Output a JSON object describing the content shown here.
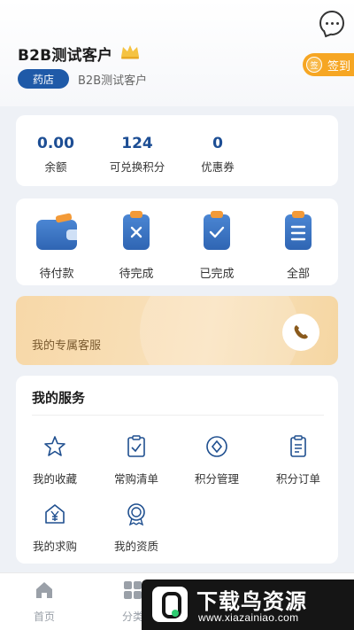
{
  "header": {
    "user_name": "B2B测试客户",
    "tag": "药店",
    "shop_name": "B2B测试客户",
    "signin": {
      "coin": "签",
      "label": "签到"
    }
  },
  "stats": [
    {
      "value": "0.00",
      "label": "余额"
    },
    {
      "value": "124",
      "label": "可兑换积分"
    },
    {
      "value": "0",
      "label": "优惠券"
    }
  ],
  "orders": [
    {
      "label": "待付款",
      "icon": "wallet-icon"
    },
    {
      "label": "待完成",
      "icon": "clipboard-x-icon"
    },
    {
      "label": "已完成",
      "icon": "clipboard-check-icon"
    },
    {
      "label": "全部",
      "icon": "clipboard-list-icon"
    }
  ],
  "service_banner": {
    "label": "我的专属客服",
    "icon": "phone-icon"
  },
  "services": {
    "title": "我的服务",
    "items": [
      {
        "label": "我的收藏",
        "icon": "star-icon"
      },
      {
        "label": "常购清单",
        "icon": "checklist-icon"
      },
      {
        "label": "积分管理",
        "icon": "diamond-icon"
      },
      {
        "label": "积分订单",
        "icon": "order-doc-icon"
      },
      {
        "label": "我的求购",
        "icon": "yen-house-icon"
      },
      {
        "label": "我的资质",
        "icon": "medal-icon"
      }
    ]
  },
  "tabbar": [
    {
      "label": "首页",
      "icon": "home-icon"
    },
    {
      "label": "分类",
      "icon": "grid-icon"
    }
  ],
  "watermark": {
    "title": "下载鸟资源",
    "url": "www.xiazainiao.com"
  },
  "colors": {
    "brand_blue": "#1f5aa8",
    "accent_orange": "#f6a623",
    "banner_tan": "#f9e2bd"
  }
}
